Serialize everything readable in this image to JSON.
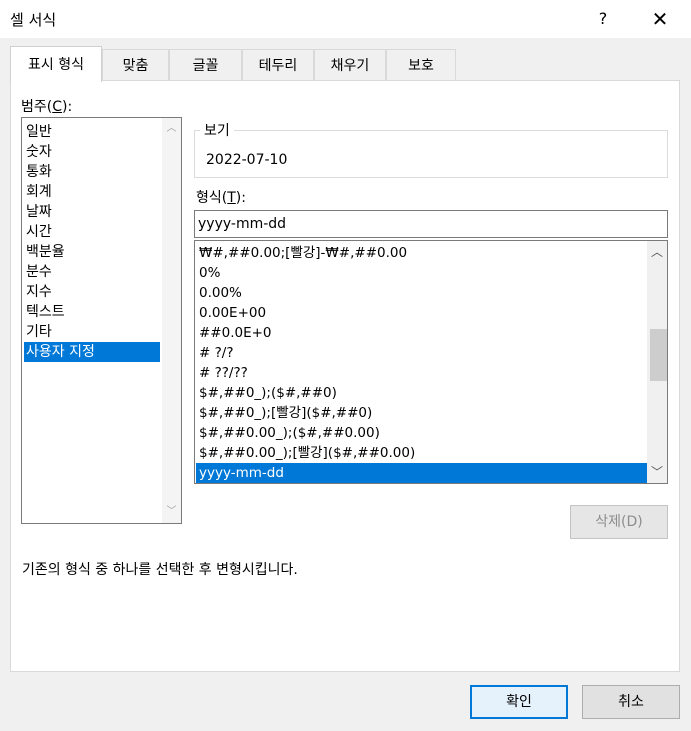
{
  "window": {
    "title": "셀 서식",
    "help": "?",
    "close": "✕"
  },
  "tabs": [
    {
      "label": "표시 형식",
      "active": true
    },
    {
      "label": "맞춤"
    },
    {
      "label": "글꼴"
    },
    {
      "label": "테두리"
    },
    {
      "label": "채우기"
    },
    {
      "label": "보호"
    }
  ],
  "category": {
    "label_prefix": "범주(",
    "label_key": "C",
    "label_suffix": "):",
    "items": [
      "일반",
      "숫자",
      "통화",
      "회계",
      "날짜",
      "시간",
      "백분율",
      "분수",
      "지수",
      "텍스트",
      "기타",
      "사용자 지정"
    ],
    "selected": "사용자 지정"
  },
  "preview": {
    "label": "보기",
    "value": "2022-07-10"
  },
  "format": {
    "label_prefix": "형식(",
    "label_key": "T",
    "label_suffix": "):",
    "value": "yyyy-mm-dd",
    "items": [
      "₩#,##0.00;[빨강]-₩#,##0.00",
      "0%",
      "0.00%",
      "0.00E+00",
      "##0.0E+0",
      "# ?/?",
      "# ??/??",
      "$#,##0_);($#,##0)",
      "$#,##0_);[빨강]($#,##0)",
      "$#,##0.00_);($#,##0.00)",
      "$#,##0.00_);[빨강]($#,##0.00)",
      "yyyy-mm-dd"
    ],
    "selected": "yyyy-mm-dd"
  },
  "delete_button": "삭제(D)",
  "description": "기존의 형식 중 하나를 선택한 후 변형시킵니다.",
  "ok_button": "확인",
  "cancel_button": "취소",
  "colors": {
    "accent": "#0078d7",
    "panel": "#ffffff",
    "background": "#f0f0f0"
  }
}
